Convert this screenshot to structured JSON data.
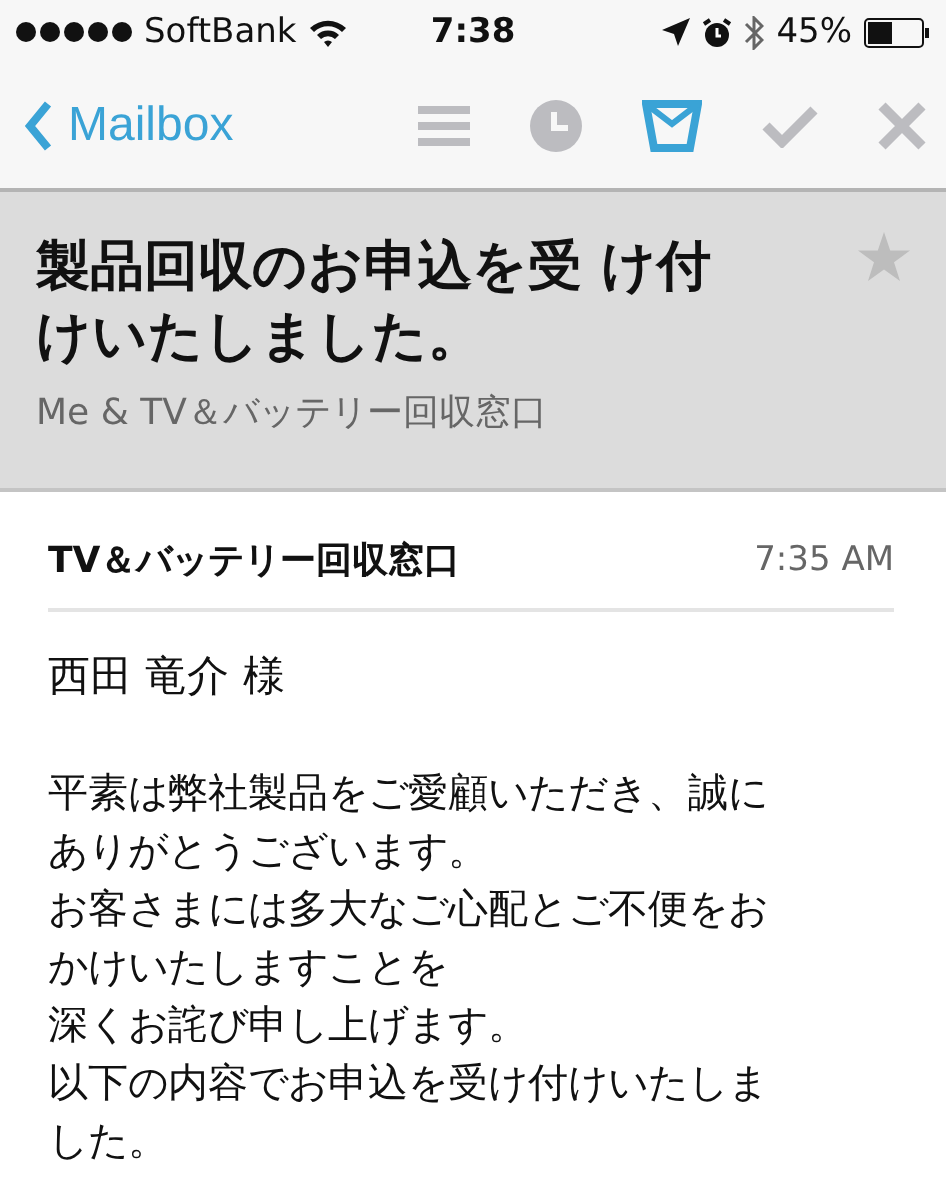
{
  "status_bar": {
    "carrier": "SoftBank",
    "time": "7:38",
    "battery": "45%"
  },
  "nav": {
    "back": "Mailbox",
    "actions": [
      {
        "kind": "list",
        "selected": false
      },
      {
        "kind": "later",
        "selected": false
      },
      {
        "kind": "inbox",
        "selected": true
      },
      {
        "kind": "done",
        "selected": false
      },
      {
        "kind": "delete",
        "selected": false
      }
    ]
  },
  "header": {
    "title_lines": [
      "製品回収のお申込を受 け付",
      "けいたしました。"
    ],
    "participants": "Me & TV＆バッテリー回収窓口",
    "starred": false
  },
  "message": {
    "sender": "TV＆バッテリー回収窓口",
    "time": "7:35 AM",
    "greeting": "西田 竜介 様",
    "body_lines": [
      "平素は弊社製品をご愛顧いただき、誠に",
      "ありがとうございます。",
      "お客さまには多大なご心配とご不便をお",
      "かけいたしますことを",
      "深くお詫び申し上げます。",
      "以下の内容でお申込を受け付けいたしま",
      "した。"
    ]
  }
}
